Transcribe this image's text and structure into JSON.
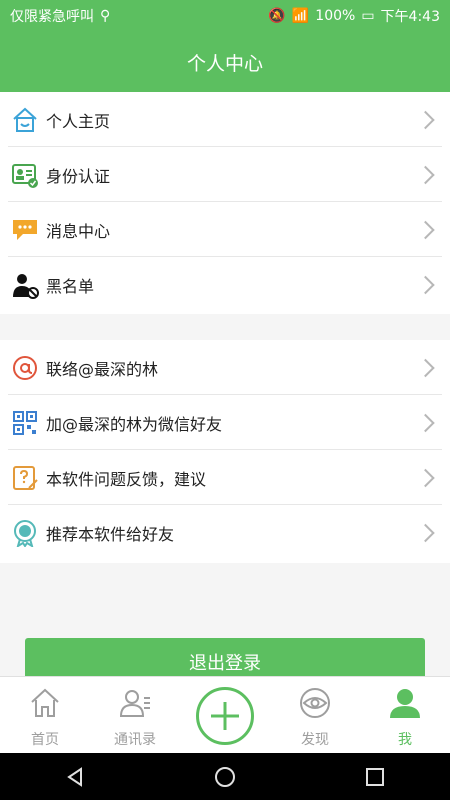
{
  "status": {
    "carrier": "仅限紧急呼叫",
    "battery": "100%",
    "time": "下午4:43"
  },
  "header": {
    "title": "个人中心"
  },
  "menu1": [
    {
      "label": "个人主页",
      "icon": "home-icon"
    },
    {
      "label": "身份认证",
      "icon": "id-card-icon"
    },
    {
      "label": "消息中心",
      "icon": "message-icon"
    },
    {
      "label": "黑名单",
      "icon": "blacklist-icon"
    }
  ],
  "menu2": [
    {
      "label": "联络@最深的林",
      "icon": "at-icon"
    },
    {
      "label": "加@最深的林为微信好友",
      "icon": "qr-code-icon"
    },
    {
      "label": "本软件问题反馈，建议",
      "icon": "feedback-icon"
    },
    {
      "label": "推荐本软件给好友",
      "icon": "badge-icon"
    }
  ],
  "logout_label": "退出登录",
  "tabs": [
    {
      "label": "首页",
      "icon": "home-outline-icon"
    },
    {
      "label": "通讯录",
      "icon": "contacts-icon"
    },
    {
      "label": "",
      "icon": "add-icon"
    },
    {
      "label": "发现",
      "icon": "eye-icon"
    },
    {
      "label": "我",
      "icon": "user-icon"
    }
  ],
  "colors": {
    "primary": "#5cbf60"
  }
}
